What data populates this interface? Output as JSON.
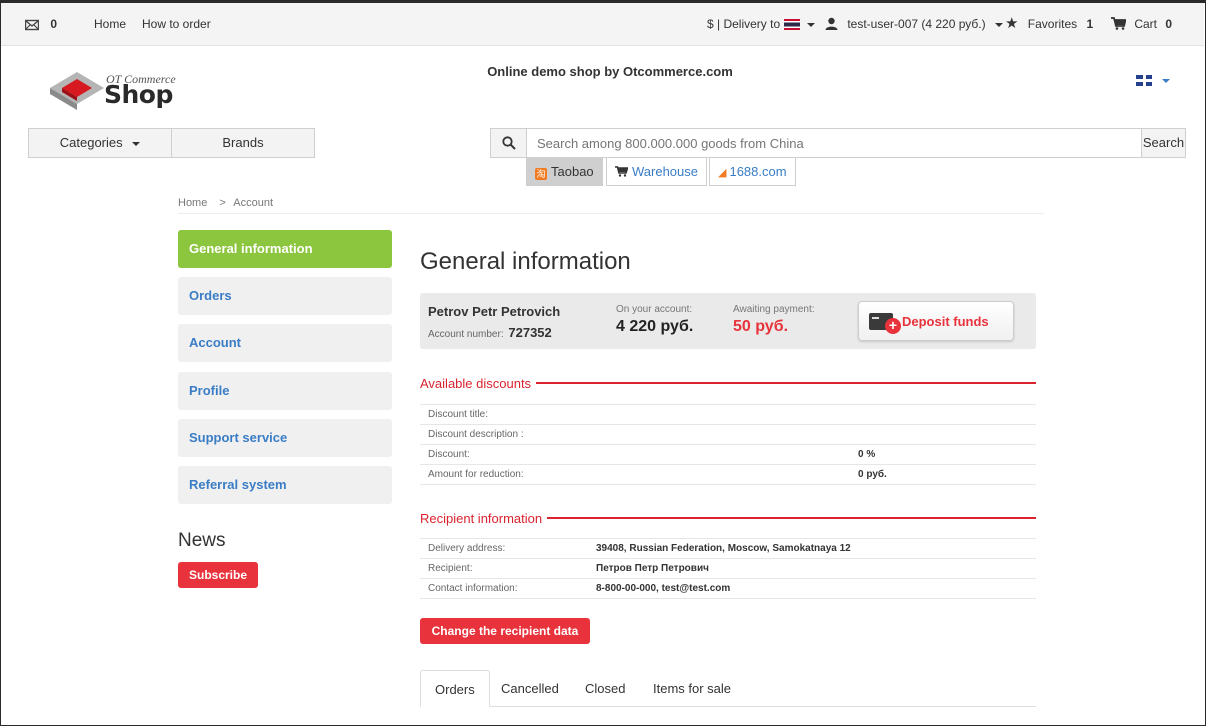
{
  "topbar": {
    "messages_count": "0",
    "home_link": "Home",
    "how_to_order_link": "How to order",
    "delivery_label": "$ | Delivery to",
    "user_label": "test-user-007 (4 220 руб.)",
    "favorites_label": "Favorites",
    "favorites_count": "1",
    "cart_label": "Cart",
    "cart_count": "0"
  },
  "header": {
    "logo_line1": "OT Commerce",
    "logo_line2": "Shop",
    "tagline": "Online demo shop by Otcommerce.com",
    "language_icon": "uk-flag-icon"
  },
  "nav": {
    "categories_label": "Categories",
    "brands_label": "Brands"
  },
  "search": {
    "placeholder": "Search among 800.000.000 goods from China",
    "button_label": "Search",
    "sources": [
      {
        "label": "Taobao"
      },
      {
        "label": "Warehouse"
      },
      {
        "label": "1688.com"
      }
    ]
  },
  "breadcrumb": {
    "home": "Home",
    "separator": ">",
    "current": "Account"
  },
  "sidebar": {
    "items": [
      {
        "label": "General information"
      },
      {
        "label": "Orders"
      },
      {
        "label": "Account"
      },
      {
        "label": "Profile"
      },
      {
        "label": "Support service"
      },
      {
        "label": "Referral system"
      }
    ],
    "news_title": "News",
    "subscribe_label": "Subscribe"
  },
  "main": {
    "title": "General information",
    "account": {
      "name": "Petrov Petr Petrovich",
      "number_label": "Account number:",
      "number": "727352",
      "balance_label": "On your account:",
      "balance": "4 220 руб.",
      "awaiting_label": "Awaiting payment:",
      "awaiting": "50 руб.",
      "deposit_label": "Deposit funds"
    },
    "discounts": {
      "title": "Available discounts",
      "rows": [
        {
          "label": "Discount title:",
          "value": ""
        },
        {
          "label": "Discount description :",
          "value": ""
        },
        {
          "label": "Discount:",
          "value": "0 %"
        },
        {
          "label": "Amount for reduction:",
          "value": "0 руб."
        }
      ]
    },
    "recipient": {
      "title": "Recipient information",
      "rows": [
        {
          "label": "Delivery address:",
          "value": "39408, Russian Federation, Moscow, Samokatnaya 12"
        },
        {
          "label": "Recipient:",
          "value": "Петров Петр Петрович"
        },
        {
          "label": "Contact information:",
          "value": "8-800-00-000, test@test.com"
        }
      ],
      "change_label": "Change the recipient data"
    },
    "tabs": [
      {
        "label": "Orders"
      },
      {
        "label": "Cancelled"
      },
      {
        "label": "Closed"
      },
      {
        "label": "Items for sale"
      }
    ]
  },
  "colors": {
    "accent_green": "#8cc63e",
    "accent_red": "#e8323c",
    "link_blue": "#3a7dc6"
  }
}
